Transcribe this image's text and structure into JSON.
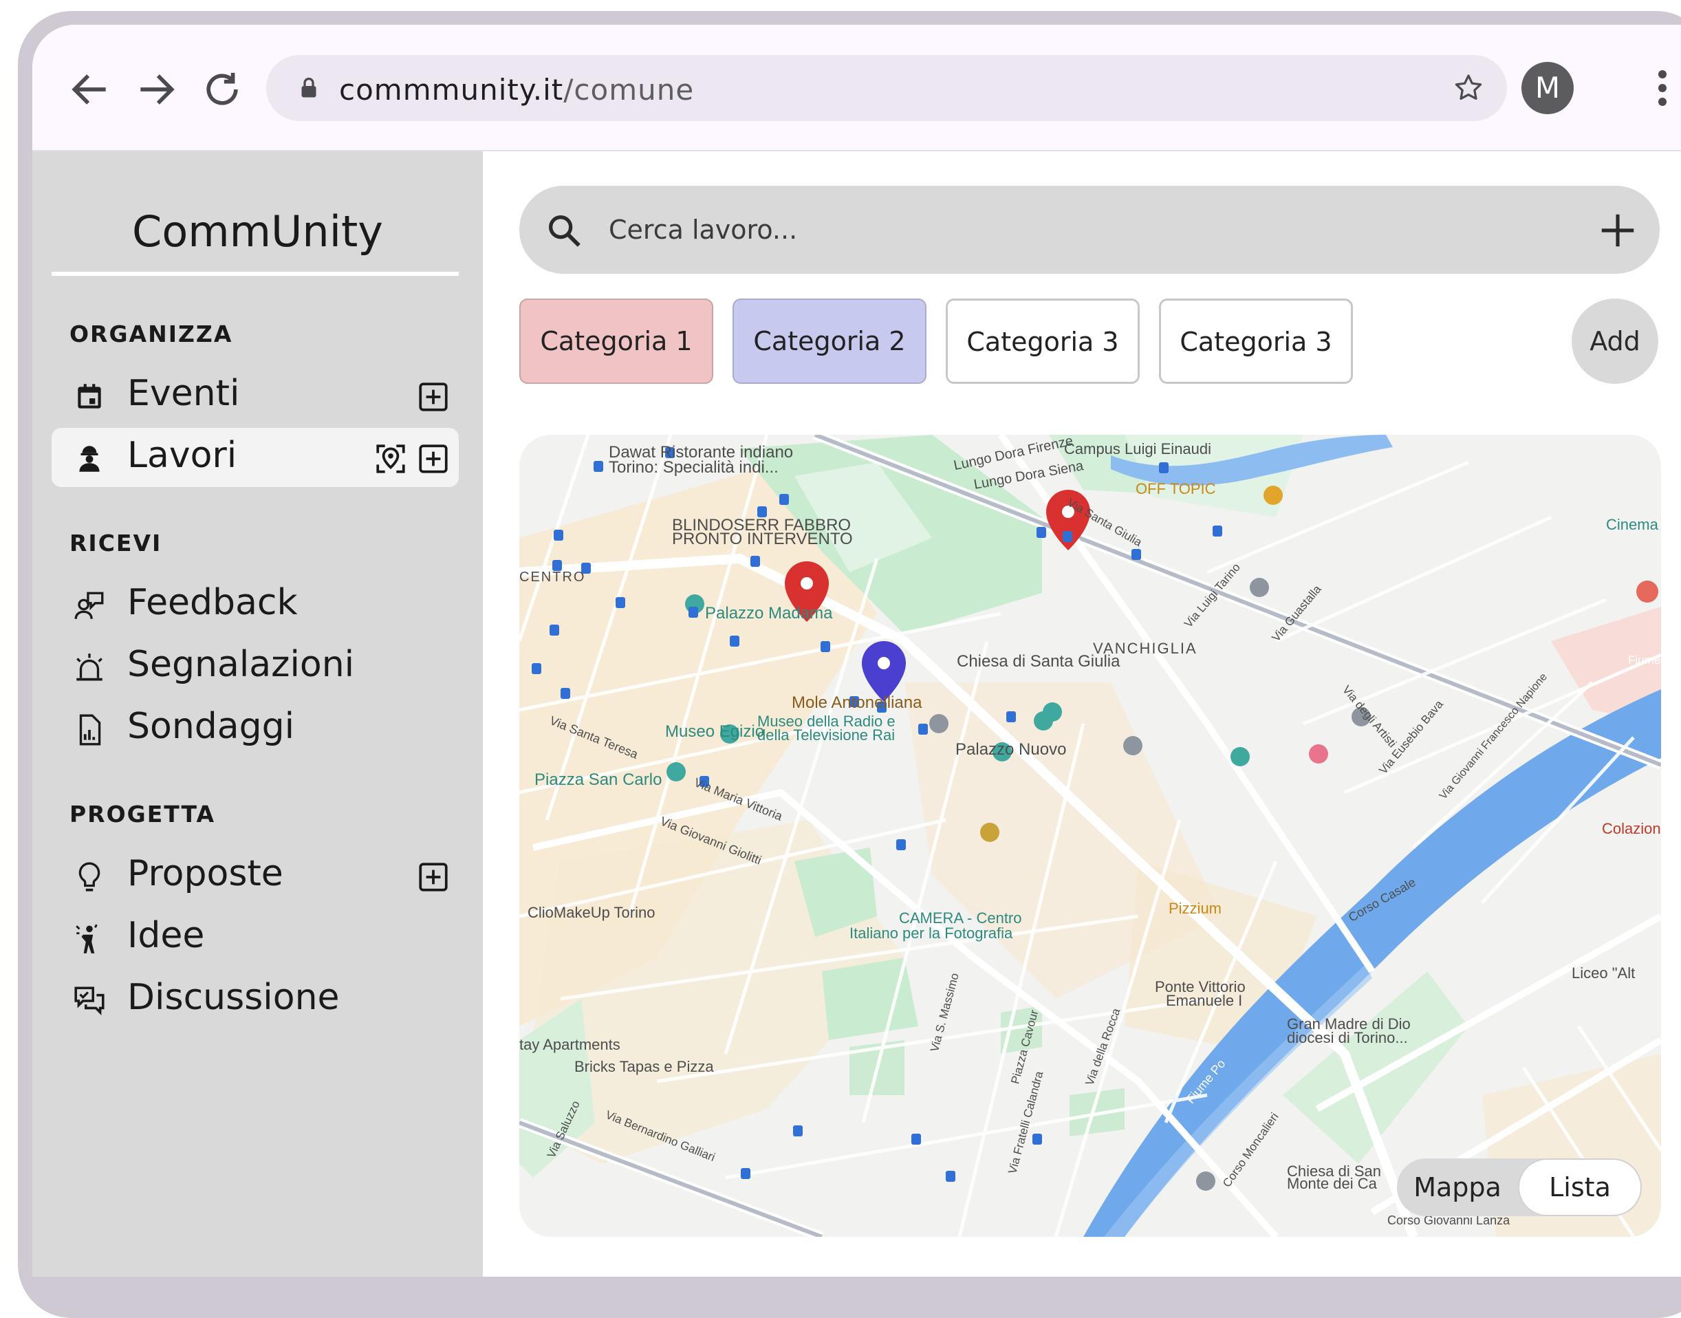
{
  "browser": {
    "url_domain": "commmunity.it",
    "url_path": "/comune",
    "avatar_letter": "M",
    "icons": [
      "back-arrow-icon",
      "forward-arrow-icon",
      "reload-icon",
      "lock-icon",
      "star-icon",
      "more-vert-icon"
    ]
  },
  "sidebar": {
    "brand": "CommUnity",
    "sections": [
      {
        "title": "ORGANIZZA",
        "items": [
          {
            "label": "Eventi",
            "icon": "calendar-icon",
            "actions": [
              "add-box-icon"
            ]
          },
          {
            "label": "Lavori",
            "icon": "worker-icon",
            "active": true,
            "actions": [
              "location-scan-icon",
              "add-box-icon"
            ]
          }
        ]
      },
      {
        "title": "RICEVI",
        "items": [
          {
            "label": "Feedback",
            "icon": "feedback-icon"
          },
          {
            "label": "Segnalazioni",
            "icon": "siren-icon"
          },
          {
            "label": "Sondaggi",
            "icon": "poll-icon"
          }
        ]
      },
      {
        "title": "PROGETTA",
        "items": [
          {
            "label": "Proposte",
            "icon": "lightbulb-icon",
            "actions": [
              "add-box-icon"
            ]
          },
          {
            "label": "Idee",
            "icon": "person-idea-icon"
          },
          {
            "label": "Discussione",
            "icon": "forum-icon"
          }
        ]
      }
    ]
  },
  "search": {
    "placeholder": "Cerca lavoro..."
  },
  "filters": {
    "chips": [
      {
        "label": "Categoria 1",
        "color": "#f0c4c4"
      },
      {
        "label": "Categoria 2",
        "color": "#c7c9ee"
      },
      {
        "label": "Categoria 3",
        "color": "#ffffff"
      },
      {
        "label": "Categoria 3",
        "color": "#ffffff"
      }
    ],
    "add_label": "Add"
  },
  "map": {
    "labels": [
      "Dawat Ristorante indiano",
      "Torino: Specialità indi...",
      "BLINDOSERR FABBRO",
      "PRONTO INTERVENTO",
      "Palazzo Madama",
      "Mole Antonelliana",
      "Museo della Radio e",
      "della Televisione Rai",
      "Museo Egizio",
      "Piazza San Carlo",
      "Chiesa di Santa Giulia",
      "VANCHIGLIA",
      "Palazzo Nuovo",
      "Campus Luigi Einaudi",
      "Lungo Dora Firenze",
      "Lungo Dora Siena",
      "OFF TOPIC",
      "Cinema F",
      "CENTRO",
      "Via Santa Teresa",
      "Via Maria Vittoria",
      "Via Giovanni Giolitti",
      "ClioMakeUp Torino",
      "CAMERA - Centro",
      "Italiano per la Fotografia",
      "Pizzium",
      "Ponte Vittorio",
      "Emanuele I",
      "Gran Madre di Dio",
      "diocesi di Torino...",
      "Fiume Po",
      "Corso Casale",
      "Liceo \"Alt",
      "Colazion",
      "Bricks Tapas e Pizza",
      "tay Apartments",
      "Chiesa di San",
      "Monte dei Ca",
      "Corso Giovanni Lanza",
      "Via Santa Giulia",
      "Via Luigi Tarino",
      "Via Guastalla",
      "Via degli Artisti",
      "Via Eusebio Bava",
      "Via Giovanni Francesco Napione",
      "Via S. Massimo",
      "Piazza Cavour",
      "Via della Rocca",
      "Via Fratelli Calandra",
      "Via Bernardino Galliari",
      "Via Saluzzo",
      "Corso Moncalieri",
      "Fiume"
    ],
    "markers": [
      {
        "name": "red-marker-1",
        "color": "#d93030"
      },
      {
        "name": "red-marker-2",
        "color": "#d93030"
      },
      {
        "name": "blue-marker",
        "color": "#4a3fcf"
      }
    ],
    "view_toggle": {
      "map_label": "Mappa",
      "list_label": "Lista",
      "selected": "Lista"
    }
  }
}
